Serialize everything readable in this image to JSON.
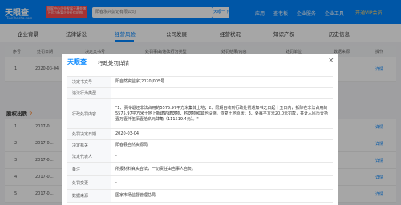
{
  "header": {
    "logo": "天眼查",
    "logo_sub": "TianYancha.com",
    "promo": "国家中小企业发展子基金旗下官方备案企业征信机构",
    "search_value": "阳春永兴彭记有限公司",
    "search_button": "天眼一下",
    "nav": [
      "应用",
      "查老板",
      "企业服务",
      "企业工具"
    ],
    "vip": "开通VIP会员"
  },
  "tabs": [
    "企业背景",
    "法律诉讼",
    "经营风险",
    "公司发展",
    "经营状况",
    "知识产权",
    "历史信息"
  ],
  "bg_table": {
    "headers": [
      "序号",
      "处罚日期",
      "决定文书号",
      "处罚事由/违法行为类型",
      "处罚结果/内容",
      "处罚单位",
      "数据来源",
      "操作"
    ],
    "row": {
      "index": "1",
      "date": "2020-03-04",
      "action": "详情"
    }
  },
  "abnormal": {
    "title": "股权出质",
    "count": "2",
    "rows": [
      {
        "index": "1",
        "date": "2017-0…",
        "action": "详情"
      },
      {
        "index": "2",
        "date": "2017-0…",
        "action": "详情"
      },
      {
        "index": "3",
        "date": "2017-0…",
        "action": "详情"
      },
      {
        "index": "4",
        "date": "2017-0…",
        "action": "详情"
      },
      {
        "index": "5",
        "date": "2017-0…",
        "action": "详情"
      }
    ]
  },
  "modal": {
    "logo": "天眼查",
    "title": "行政处罚详情",
    "close": "×",
    "rows": [
      {
        "label": "决定书文号",
        "value": "阳自然资监字[2020]005号"
      },
      {
        "label": "违法行为类型",
        "value": ""
      },
      {
        "label": "行政处罚内容",
        "value": "\"1、责令退还非法占用的5575.97平方米集体土地；2、限期自收到行政处罚通知书之日起十五日内，拆除在非法占用的5575.97平方米土地上新建的建筑物、构筑物和其他设施，恢复土地原状；3、处每平方米20.0元罚款，共计人民币壹拾壹万壹仟伍佰壹拾玖元肆角（111519.4元）。\""
      },
      {
        "label": "处罚决定日期",
        "value": "2020-03-04"
      },
      {
        "label": "决定机关",
        "value": "阳春县自然资源局"
      },
      {
        "label": "法定代表人",
        "value": "-"
      },
      {
        "label": "备注",
        "value": "所报材料真实合法，一切责任由当事人自负。"
      },
      {
        "label": "处罚变更",
        "value": "-"
      },
      {
        "label": "数据来源",
        "value": "国家市场监督管理总局"
      }
    ]
  }
}
